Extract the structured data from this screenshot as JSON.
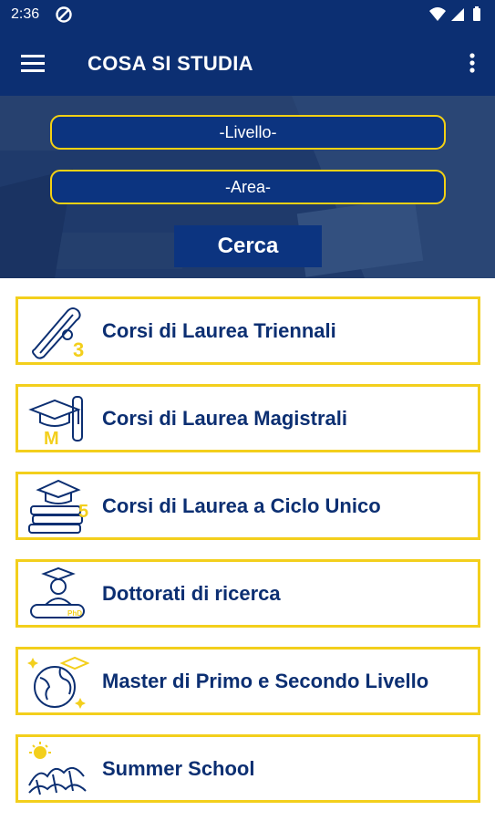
{
  "status_bar": {
    "time": "2:36"
  },
  "app_bar": {
    "title": "COSA SI STUDIA"
  },
  "search": {
    "level_placeholder": "-Livello-",
    "area_placeholder": "-Area-",
    "button_label": "Cerca"
  },
  "courses": [
    {
      "label": "Corsi di Laurea Triennali",
      "icon": "diploma-scroll-3-icon",
      "badge": "3"
    },
    {
      "label": "Corsi di Laurea Magistrali",
      "icon": "graduation-cap-scroll-icon",
      "badge": "M"
    },
    {
      "label": "Corsi di Laurea a Ciclo Unico",
      "icon": "books-graduation-cap-icon",
      "badge": "5"
    },
    {
      "label": "Dottorati di ricerca",
      "icon": "doctorate-graduate-icon",
      "badge": "PhD"
    },
    {
      "label": "Master di Primo e Secondo Livello",
      "icon": "globe-graduation-cap-icon"
    },
    {
      "label": "Summer School",
      "icon": "sun-waves-icon"
    }
  ],
  "colors": {
    "primary_navy": "#0c2f72",
    "accent_yellow": "#f3cf1c",
    "text_on_primary": "#ffffff"
  }
}
